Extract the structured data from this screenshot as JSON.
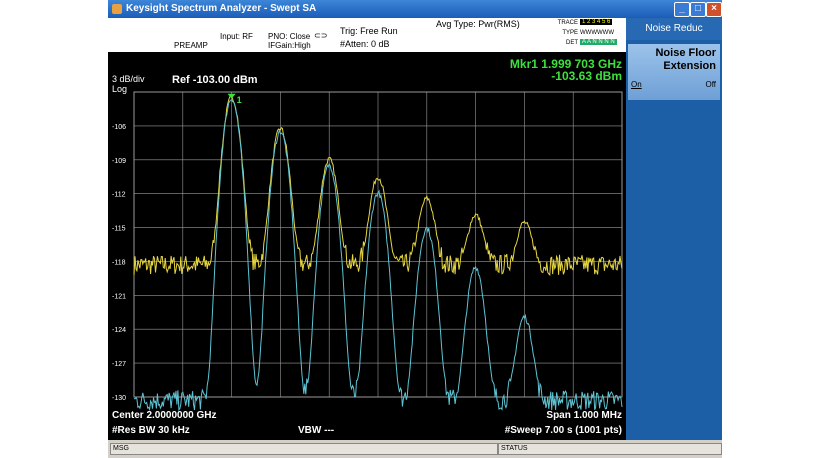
{
  "window": {
    "title": "Keysight Spectrum Analyzer - Swept SA"
  },
  "info": {
    "input": "Input: RF",
    "preamp": "PREAMP",
    "pno": "PNO: Close",
    "ifgain": "IFGain:High",
    "trig": "Trig: Free Run",
    "atten": "#Atten: 0 dB",
    "avg_type": "Avg Type: Pwr(RMS)",
    "trace_label": "TRACE",
    "trace_value": "1 2 3 4 5 6",
    "type_label": "TYPE",
    "type_value": "WWWWWW",
    "det_label": "DET",
    "det_value": "A A N N N N"
  },
  "display": {
    "scale": "3 dB/div",
    "log": "Log",
    "ref": "Ref -103.00 dBm",
    "marker_freq": "Mkr1 1.999 703 GHz",
    "marker_amp": "-103.63 dBm",
    "marker_label": "1",
    "y_ticks": [
      "-106",
      "-109",
      "-112",
      "-115",
      "-118",
      "-121",
      "-124",
      "-127",
      "-130"
    ],
    "center": "Center 2.0000000 GHz",
    "res_bw": "#Res BW 30 kHz",
    "vbw": "VBW ---",
    "span": "Span 1.000 MHz",
    "sweep": "#Sweep  7.00 s (1001 pts)"
  },
  "softkeys": {
    "menu_title": "Noise Reduc",
    "key1_line1": "Noise Floor",
    "key1_line2": "Extension",
    "key1_on": "On",
    "key1_off": "Off"
  },
  "status": {
    "msg": "MSG",
    "status": "STATUS"
  },
  "colors": {
    "trace1": "#e6d640",
    "trace2": "#5ec4d4",
    "marker": "#3ee03e",
    "grid": "#9a9a9a"
  },
  "chart_data": {
    "type": "line",
    "xlabel": "",
    "ylabel": "",
    "ylim": [
      -130,
      -103
    ],
    "y_step": 3,
    "x_center_ghz": 2.0,
    "x_span_mhz": 1.0,
    "series": [
      {
        "name": "",
        "color": "#e6d640",
        "floor": -118.3,
        "peaks": [
          {
            "x": 0.2,
            "y": -103.6
          },
          {
            "x": 0.3,
            "y": -106.5
          },
          {
            "x": 0.4,
            "y": -109.5
          },
          {
            "x": 0.5,
            "y": -111.3
          },
          {
            "x": 0.6,
            "y": -113.7
          },
          {
            "x": 0.7,
            "y": -115.8
          },
          {
            "x": 0.8,
            "y": -116.9
          }
        ]
      },
      {
        "name": "",
        "color": "#5ec4d4",
        "floor": -130.3,
        "peaks": [
          {
            "x": 0.2,
            "y": -103.6
          },
          {
            "x": 0.3,
            "y": -106.5
          },
          {
            "x": 0.4,
            "y": -109.5
          },
          {
            "x": 0.5,
            "y": -112.0
          },
          {
            "x": 0.6,
            "y": -115.2
          },
          {
            "x": 0.7,
            "y": -118.8
          },
          {
            "x": 0.8,
            "y": -123.8
          }
        ]
      }
    ]
  }
}
